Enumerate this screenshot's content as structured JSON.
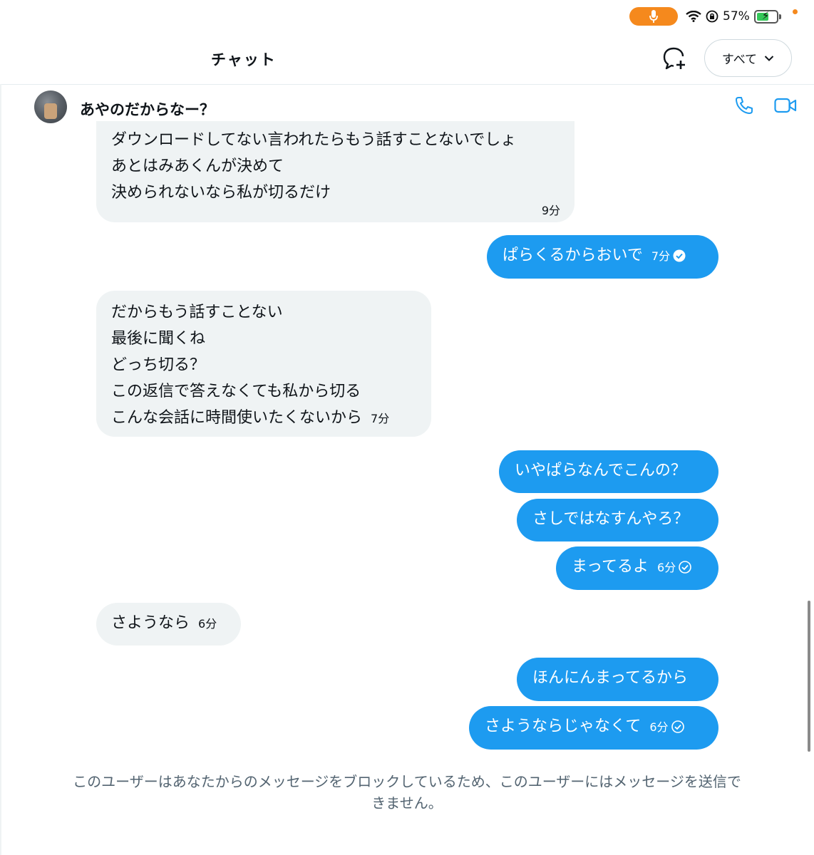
{
  "status_bar": {
    "battery_percent": "57%",
    "mic_color": "#f5891d"
  },
  "header": {
    "title": "チャット",
    "filter_label": "すべて"
  },
  "conversation": {
    "name": "あやのだからなー？"
  },
  "messages": [
    {
      "dir": "in",
      "lines": [
        "ダウンロードしてない言われたらもう話すことないでしょ",
        "あとはみあくんが決めて",
        "決められないなら私が切るだけ"
      ],
      "time": "9分"
    },
    {
      "dir": "out",
      "lines": [
        "ぱらくるからおいで"
      ],
      "time": "7分",
      "status": "read"
    },
    {
      "dir": "in",
      "lines": [
        "だからもう話すことない",
        "最後に聞くね",
        "どっち切る？",
        "この返信で答えなくても私から切る",
        "こんな会話に時間使いたくないから"
      ],
      "time": "7分"
    },
    {
      "dir": "out",
      "lines": [
        "いやぱらなんでこんの？"
      ]
    },
    {
      "dir": "out",
      "lines": [
        "さしではなすんやろ？"
      ]
    },
    {
      "dir": "out",
      "lines": [
        "まってるよ"
      ],
      "time": "6分",
      "status": "sent"
    },
    {
      "dir": "in",
      "lines": [
        "さようなら"
      ],
      "time": "6分"
    },
    {
      "dir": "out",
      "lines": [
        "ほんにんまってるから"
      ]
    },
    {
      "dir": "out",
      "lines": [
        "さようならじゃなくて"
      ],
      "time": "6分",
      "status": "sent"
    }
  ],
  "notice": {
    "line1": "このユーザーはあなたからのメッセージをブロックしているため、このユーザーにはメッセージを送信で",
    "line2": "きません。"
  },
  "colors": {
    "accent": "#1d9bf0",
    "incoming_bubble": "#eff3f4",
    "secondary_text": "#536471"
  }
}
